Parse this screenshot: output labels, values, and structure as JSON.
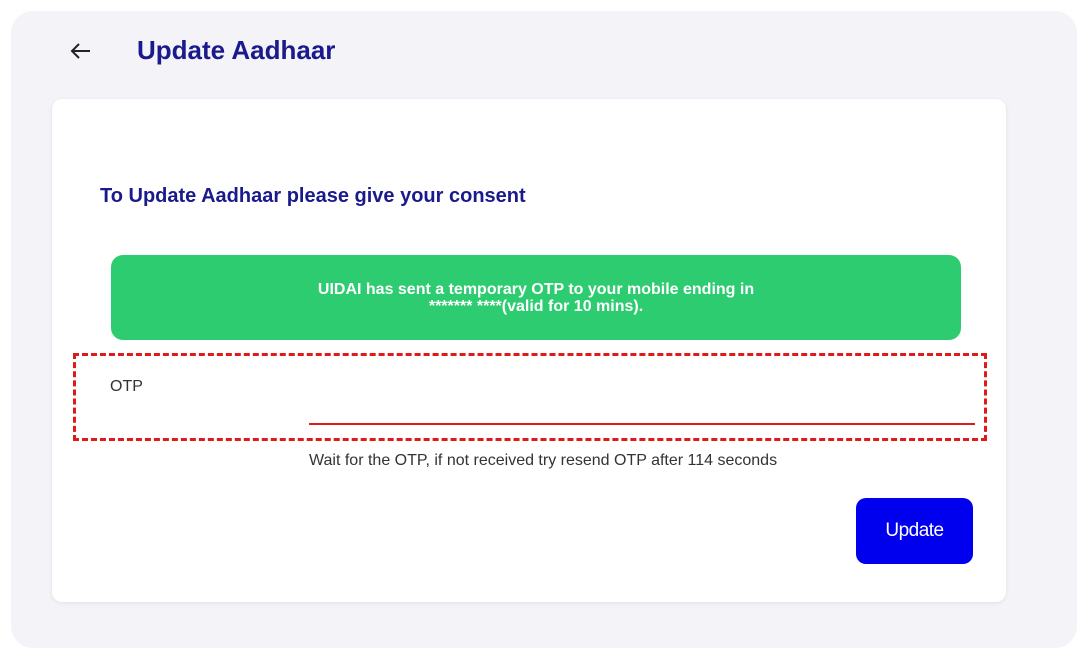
{
  "header": {
    "title": "Update Aadhaar",
    "back_icon": "arrow-left-icon"
  },
  "form": {
    "consent_heading": "To Update Aadhaar please give your consent",
    "otp_banner": "UIDAI has sent a temporary OTP to your mobile ending in ******* ****(valid for 10 mins).",
    "otp_label": "OTP",
    "otp_value": "",
    "resend_info": "Wait for the OTP, if not received try resend OTP after 114 seconds",
    "submit_label": "Update"
  },
  "colors": {
    "title": "#1a1a8c",
    "banner": "#2ecc71",
    "highlight": "#e01919",
    "button": "#0000ee"
  }
}
